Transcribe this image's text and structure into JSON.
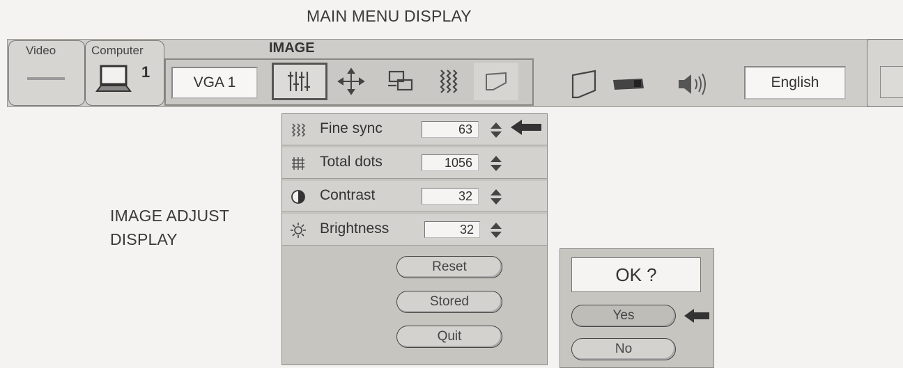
{
  "captions": {
    "main_menu": "MAIN MENU DISPLAY",
    "image_adjust_line1": "IMAGE ADJUST",
    "image_adjust_line2": "DISPLAY"
  },
  "menubar": {
    "tabs": [
      {
        "label": "Video"
      },
      {
        "label": "Computer",
        "number": "1"
      }
    ],
    "section_title": "IMAGE",
    "source": "VGA 1",
    "language": "English"
  },
  "image_adjust": {
    "rows": [
      {
        "label": "Fine sync",
        "value": "63",
        "icon": "fine-sync-icon"
      },
      {
        "label": "Total dots",
        "value": "1056",
        "icon": "total-dots-icon"
      },
      {
        "label": "Contrast",
        "value": "32",
        "icon": "contrast-icon"
      },
      {
        "label": "Brightness",
        "value": "32",
        "icon": "brightness-icon"
      }
    ],
    "buttons": {
      "reset": "Reset",
      "stored": "Stored",
      "quit": "Quit"
    }
  },
  "confirm": {
    "prompt": "OK ?",
    "yes": "Yes",
    "no": "No"
  },
  "colors": {
    "panel": "#c7c5c0",
    "bar": "#cfcdc9",
    "pointer": "#333333"
  }
}
